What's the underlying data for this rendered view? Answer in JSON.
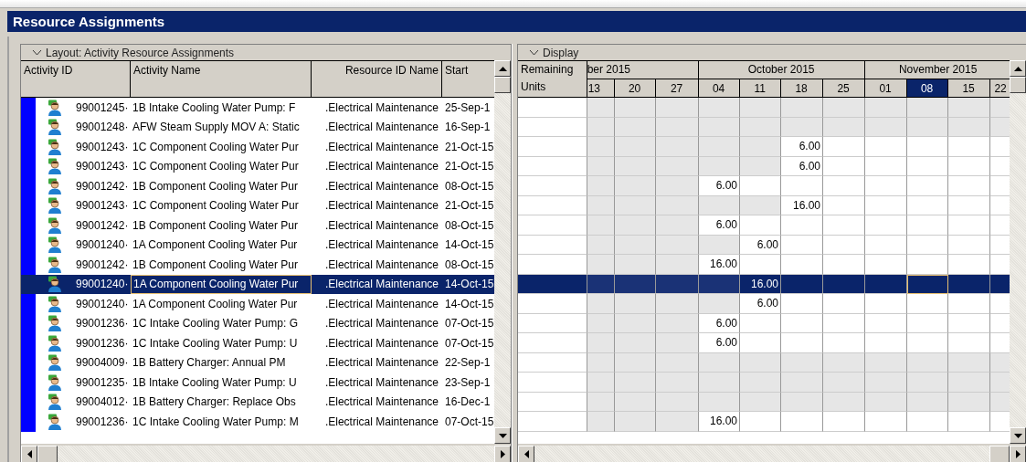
{
  "window": {
    "title": "Resource Assignments"
  },
  "left_panel": {
    "title": "Layout: Activity Resource Assignments",
    "columns": [
      "Activity ID",
      "Activity Name",
      "Resource ID Name",
      "Start"
    ],
    "rows": [
      {
        "id": "99001245·",
        "name": "1B Intake Cooling Water Pump: F",
        "resource": ".Electrical Maintenance",
        "start": "25-Sep-1",
        "selected": false
      },
      {
        "id": "99001248·",
        "name": "AFW Steam Supply MOV A: Static",
        "resource": ".Electrical Maintenance",
        "start": "16-Sep-1",
        "selected": false
      },
      {
        "id": "99001243·",
        "name": "1C Component Cooling Water Pur",
        "resource": ".Electrical Maintenance",
        "start": "21-Oct-15",
        "selected": false
      },
      {
        "id": "99001243·",
        "name": "1C Component Cooling Water Pur",
        "resource": ".Electrical Maintenance",
        "start": "21-Oct-15",
        "selected": false
      },
      {
        "id": "99001242·",
        "name": "1B Component Cooling Water Pur",
        "resource": ".Electrical Maintenance",
        "start": "08-Oct-15",
        "selected": false
      },
      {
        "id": "99001243·",
        "name": "1C Component Cooling Water Pur",
        "resource": ".Electrical Maintenance",
        "start": "21-Oct-15",
        "selected": false
      },
      {
        "id": "99001242·",
        "name": "1B Component Cooling Water Pur",
        "resource": ".Electrical Maintenance",
        "start": "08-Oct-15",
        "selected": false
      },
      {
        "id": "99001240·",
        "name": "1A Component Cooling Water Pur",
        "resource": ".Electrical Maintenance",
        "start": "14-Oct-15",
        "selected": false
      },
      {
        "id": "99001242·",
        "name": "1B Component Cooling Water Pur",
        "resource": ".Electrical Maintenance",
        "start": "08-Oct-15",
        "selected": false
      },
      {
        "id": "99001240·",
        "name": "1A Component Cooling Water Pur",
        "resource": ".Electrical Maintenance",
        "start": "14-Oct-15",
        "selected": true
      },
      {
        "id": "99001240·",
        "name": "1A Component Cooling Water Pur",
        "resource": ".Electrical Maintenance",
        "start": "14-Oct-15",
        "selected": false
      },
      {
        "id": "99001236·",
        "name": "1C Intake Cooling Water Pump: G",
        "resource": ".Electrical Maintenance",
        "start": "07-Oct-15",
        "selected": false
      },
      {
        "id": "99001236·",
        "name": "1C Intake Cooling Water Pump: U",
        "resource": ".Electrical Maintenance",
        "start": "07-Oct-15",
        "selected": false
      },
      {
        "id": "99004009·",
        "name": "1B Battery Charger: Annual PM",
        "resource": ".Electrical Maintenance",
        "start": "22-Sep-1",
        "selected": false
      },
      {
        "id": "99001235·",
        "name": "1B Intake Cooling Water Pump: U",
        "resource": ".Electrical Maintenance",
        "start": "23-Sep-1",
        "selected": false
      },
      {
        "id": "99004012·",
        "name": "1B Battery Charger: Replace Obs",
        "resource": ".Electrical Maintenance",
        "start": "16-Dec-1",
        "selected": false
      },
      {
        "id": "99001236·",
        "name": "1C Intake Cooling Water Pump: M",
        "resource": ".Electrical Maintenance",
        "start": "07-Oct-15",
        "selected": false
      }
    ]
  },
  "right_panel": {
    "title": "Display",
    "units_column": "Remaining Units",
    "months": [
      "ber 2015",
      "October 2015",
      "November 2015"
    ],
    "weeks": [
      {
        "label": "13",
        "selected": false
      },
      {
        "label": "20",
        "selected": false
      },
      {
        "label": "27",
        "selected": false
      },
      {
        "label": "04",
        "selected": false
      },
      {
        "label": "11",
        "selected": false
      },
      {
        "label": "18",
        "selected": false
      },
      {
        "label": "25",
        "selected": false
      },
      {
        "label": "01",
        "selected": false
      },
      {
        "label": "08",
        "selected": true
      },
      {
        "label": "15",
        "selected": false
      },
      {
        "label": "22",
        "selected": false
      }
    ],
    "rows": [
      {
        "cells": [
          {
            "active": false
          },
          {
            "active": false
          },
          {
            "active": false
          },
          {
            "active": false
          },
          {
            "active": false
          },
          {
            "active": false
          },
          {
            "active": false
          },
          {
            "active": false
          },
          {
            "active": false
          },
          {
            "active": false
          },
          {
            "active": false
          }
        ]
      },
      {
        "cells": [
          {
            "active": false
          },
          {
            "active": false
          },
          {
            "active": false
          },
          {
            "active": false
          },
          {
            "active": false
          },
          {
            "active": false
          },
          {
            "active": false
          },
          {
            "active": false
          },
          {
            "active": false
          },
          {
            "active": false
          },
          {
            "active": false
          }
        ]
      },
      {
        "cells": [
          {
            "active": false
          },
          {
            "active": false
          },
          {
            "active": false
          },
          {
            "active": false
          },
          {
            "active": false
          },
          {
            "active": true,
            "value": "6.00"
          },
          {
            "active": true
          },
          {
            "active": true
          },
          {
            "active": true
          },
          {
            "active": true
          },
          {
            "active": true
          }
        ]
      },
      {
        "cells": [
          {
            "active": false
          },
          {
            "active": false
          },
          {
            "active": false
          },
          {
            "active": false
          },
          {
            "active": false
          },
          {
            "active": true,
            "value": "6.00"
          },
          {
            "active": true
          },
          {
            "active": true
          },
          {
            "active": true
          },
          {
            "active": true
          },
          {
            "active": true
          }
        ]
      },
      {
        "cells": [
          {
            "active": false
          },
          {
            "active": false
          },
          {
            "active": false
          },
          {
            "active": true,
            "value": "6.00"
          },
          {
            "active": true
          },
          {
            "active": true
          },
          {
            "active": true
          },
          {
            "active": true
          },
          {
            "active": true
          },
          {
            "active": true
          },
          {
            "active": true
          }
        ]
      },
      {
        "cells": [
          {
            "active": false
          },
          {
            "active": false
          },
          {
            "active": false
          },
          {
            "active": false
          },
          {
            "active": false
          },
          {
            "active": true,
            "value": "16.00"
          },
          {
            "active": true
          },
          {
            "active": true
          },
          {
            "active": true
          },
          {
            "active": true
          },
          {
            "active": true
          }
        ]
      },
      {
        "cells": [
          {
            "active": false
          },
          {
            "active": false
          },
          {
            "active": false
          },
          {
            "active": true,
            "value": "6.00"
          },
          {
            "active": true
          },
          {
            "active": true
          },
          {
            "active": true
          },
          {
            "active": true
          },
          {
            "active": true
          },
          {
            "active": true
          },
          {
            "active": true
          }
        ]
      },
      {
        "cells": [
          {
            "active": false
          },
          {
            "active": false
          },
          {
            "active": false
          },
          {
            "active": false
          },
          {
            "active": true,
            "value": "6.00"
          },
          {
            "active": true
          },
          {
            "active": true
          },
          {
            "active": true
          },
          {
            "active": true
          },
          {
            "active": true
          },
          {
            "active": true
          }
        ]
      },
      {
        "cells": [
          {
            "active": false
          },
          {
            "active": false
          },
          {
            "active": false
          },
          {
            "active": true,
            "value": "16.00"
          },
          {
            "active": true
          },
          {
            "active": true
          },
          {
            "active": true
          },
          {
            "active": true
          },
          {
            "active": true
          },
          {
            "active": true
          },
          {
            "active": true
          }
        ]
      },
      {
        "cells": [
          {
            "active": false
          },
          {
            "active": false
          },
          {
            "active": false
          },
          {
            "active": false
          },
          {
            "active": true,
            "value": "16.00"
          },
          {
            "active": true
          },
          {
            "active": true
          },
          {
            "active": true
          },
          {
            "active": true
          },
          {
            "active": true
          },
          {
            "active": true
          }
        ]
      },
      {
        "cells": [
          {
            "active": false
          },
          {
            "active": false
          },
          {
            "active": false
          },
          {
            "active": false
          },
          {
            "active": true,
            "value": "6.00"
          },
          {
            "active": true
          },
          {
            "active": true
          },
          {
            "active": true
          },
          {
            "active": true
          },
          {
            "active": true
          },
          {
            "active": true
          }
        ]
      },
      {
        "cells": [
          {
            "active": false
          },
          {
            "active": false
          },
          {
            "active": false
          },
          {
            "active": true,
            "value": "6.00"
          },
          {
            "active": true
          },
          {
            "active": true
          },
          {
            "active": true
          },
          {
            "active": true
          },
          {
            "active": true
          },
          {
            "active": true
          },
          {
            "active": true
          }
        ]
      },
      {
        "cells": [
          {
            "active": false
          },
          {
            "active": false
          },
          {
            "active": false
          },
          {
            "active": true,
            "value": "6.00"
          },
          {
            "active": true
          },
          {
            "active": true
          },
          {
            "active": true
          },
          {
            "active": true
          },
          {
            "active": true
          },
          {
            "active": true
          },
          {
            "active": true
          }
        ]
      },
      {
        "cells": [
          {
            "active": false
          },
          {
            "active": false
          },
          {
            "active": false
          },
          {
            "active": false
          },
          {
            "active": false
          },
          {
            "active": false
          },
          {
            "active": false
          },
          {
            "active": false
          },
          {
            "active": false
          },
          {
            "active": false
          },
          {
            "active": false
          }
        ]
      },
      {
        "cells": [
          {
            "active": false
          },
          {
            "active": false
          },
          {
            "active": false
          },
          {
            "active": false
          },
          {
            "active": false
          },
          {
            "active": false
          },
          {
            "active": false
          },
          {
            "active": false
          },
          {
            "active": false
          },
          {
            "active": false
          },
          {
            "active": false
          }
        ]
      },
      {
        "cells": [
          {
            "active": false
          },
          {
            "active": false
          },
          {
            "active": false
          },
          {
            "active": false
          },
          {
            "active": false
          },
          {
            "active": false
          },
          {
            "active": false
          },
          {
            "active": false
          },
          {
            "active": false
          },
          {
            "active": false
          },
          {
            "active": false
          }
        ]
      },
      {
        "cells": [
          {
            "active": false
          },
          {
            "active": false
          },
          {
            "active": false
          },
          {
            "active": true,
            "value": "16.00"
          },
          {
            "active": true
          },
          {
            "active": true
          },
          {
            "active": true
          },
          {
            "active": true
          },
          {
            "active": true
          },
          {
            "active": true
          },
          {
            "active": true
          }
        ]
      }
    ]
  }
}
